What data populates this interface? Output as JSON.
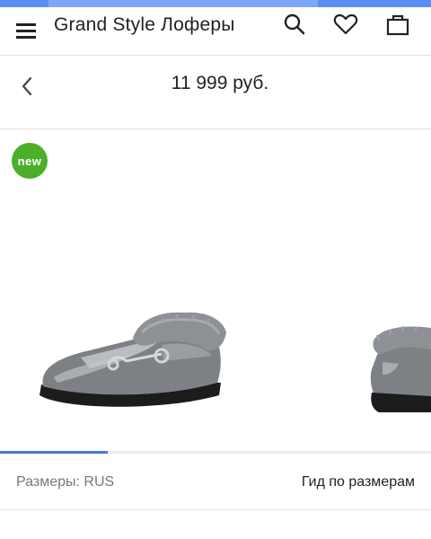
{
  "header": {
    "title": "Grand Style Лоферы"
  },
  "price_row": {
    "price": "11 999 руб."
  },
  "gallery": {
    "badge": "new",
    "progress": 0.25
  },
  "sizes_row": {
    "sizes_label": "Размеры: RUS",
    "size_guide": "Гид по размерам"
  },
  "icons": [
    "menu-icon",
    "search-icon",
    "heart-icon",
    "bag-icon",
    "chevron-left-icon"
  ],
  "colors": {
    "accent": "#4a78d6",
    "badge": "#4caf2a",
    "status_bar": "#5c8ef2"
  }
}
